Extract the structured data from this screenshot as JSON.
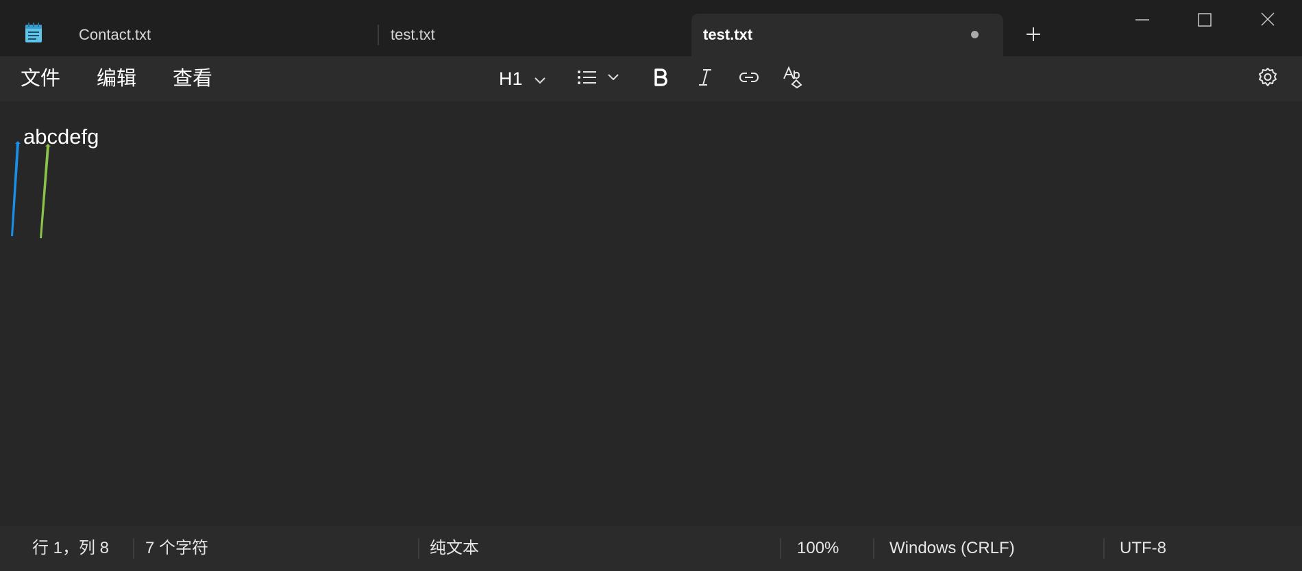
{
  "tabs": [
    {
      "label": "Contact.txt",
      "active": false
    },
    {
      "label": "test.txt",
      "active": false
    },
    {
      "label": "test.txt",
      "active": true,
      "unsaved": true
    }
  ],
  "icons": {
    "app": "notepad-icon",
    "new_tab": "plus-icon",
    "minimize": "minimize-icon",
    "maximize": "maximize-icon",
    "close": "close-icon",
    "list": "bullet-list-icon",
    "bold": "bold-icon",
    "italic": "italic-icon",
    "link": "link-icon",
    "spellcheck": "spellcheck-icon",
    "settings": "gear-icon"
  },
  "menu": {
    "file": "文件",
    "edit": "编辑",
    "view": "查看"
  },
  "toolbar": {
    "heading_label": "H1"
  },
  "editor": {
    "content": "abcdefg"
  },
  "statusbar": {
    "position": "行 1，列 8",
    "char_count": "7 个字符",
    "format": "纯文本",
    "zoom": "100%",
    "line_ending": "Windows (CRLF)",
    "encoding": "UTF-8"
  },
  "colors": {
    "background": "#272727",
    "titlebar": "#1f1f1f",
    "toolbar": "#2c2c2c",
    "accent_app_icon": "#5ec4e8",
    "handle_blue": "#1a8fe8",
    "handle_green": "#8bc34a"
  }
}
